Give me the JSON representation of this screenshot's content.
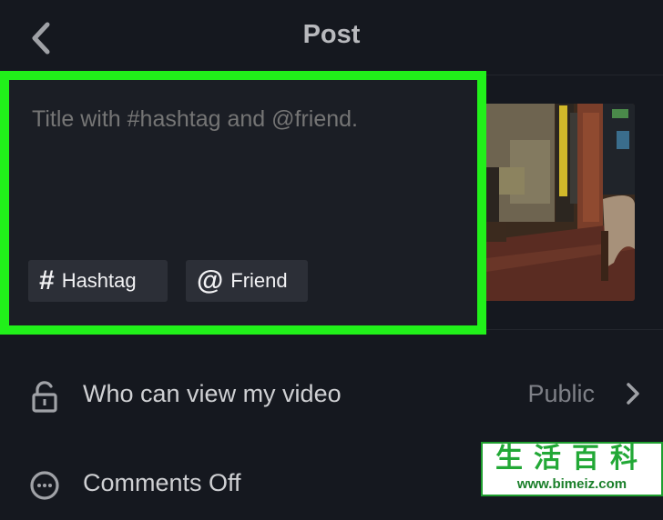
{
  "header": {
    "title": "Post",
    "back_icon": "chevron-left-icon"
  },
  "caption": {
    "placeholder": "Title with #hashtag and @friend.",
    "value": "",
    "highlight_color": "#21f01a"
  },
  "chips": {
    "hashtag": {
      "icon": "#",
      "label": "Hashtag"
    },
    "friend": {
      "icon": "@",
      "label": "Friend"
    }
  },
  "settings": {
    "privacy": {
      "icon": "unlock-icon",
      "label": "Who can view my video",
      "value": "Public"
    },
    "comments": {
      "icon": "comment-icon",
      "label": "Comments Off"
    }
  },
  "watermark": {
    "chars": "生活百科",
    "url": "www.bimeiz.com"
  }
}
